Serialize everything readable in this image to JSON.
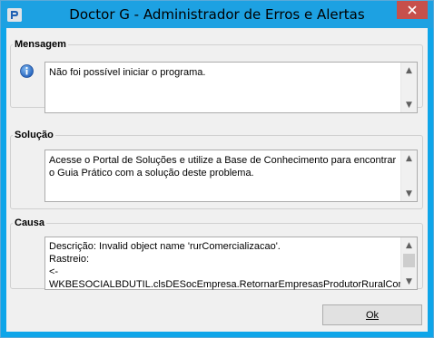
{
  "window": {
    "title": "Doctor G - Administrador de Erros e Alertas"
  },
  "sections": {
    "mensagem": {
      "label": "Mensagem",
      "text": "Não foi possível iniciar o programa."
    },
    "solucao": {
      "label": "Solução",
      "text": "Acesse o Portal de Soluções e utilize a Base de Conhecimento para encontrar o Guia Prático com a solução deste problema."
    },
    "causa": {
      "label": "Causa",
      "lines": [
        "Descrição: Invalid object name 'rurComercializacao'.",
        "Rastreio:",
        "<-",
        "WKBESOCIALBDUTIL.clsDESocEmpresa.RetornarEmpresasProdutorRuralComer"
      ]
    }
  },
  "buttons": {
    "ok": "Ok"
  },
  "icons": {
    "app": "app-logo-icon",
    "close": "close-icon",
    "info": "info-icon"
  },
  "colors": {
    "titlebar": "#1da1e2",
    "close": "#c7504b"
  }
}
